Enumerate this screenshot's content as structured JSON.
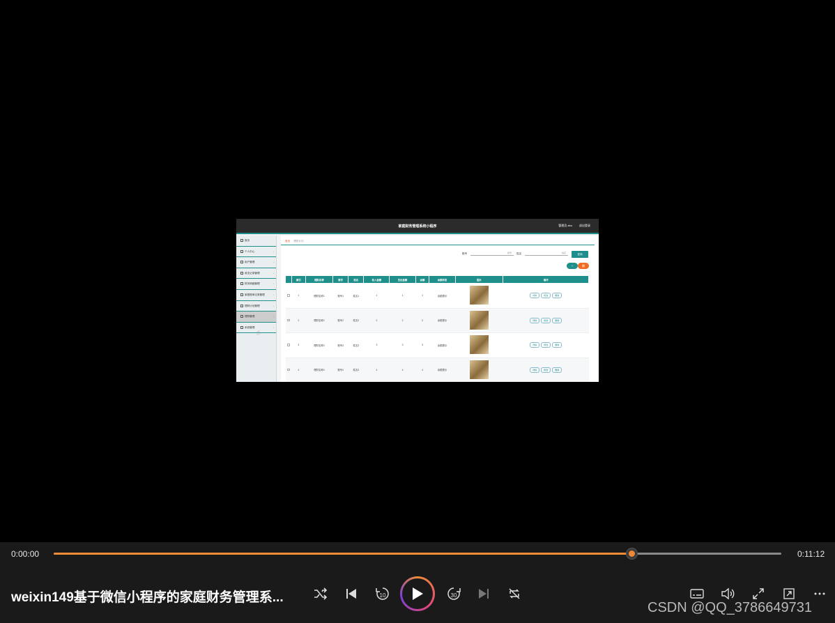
{
  "frame": {
    "app_title": "家庭财务管理系统小程序",
    "admin_label": "管理员 abo",
    "logout_label": "退出登录",
    "breadcrumb": {
      "home": "首页",
      "current": "理财计划"
    },
    "sidebar": [
      {
        "label": "首页",
        "icon": "home-icon"
      },
      {
        "label": "个人中心",
        "icon": "user-icon"
      },
      {
        "label": "用户管理",
        "icon": "grid-icon"
      },
      {
        "label": "收支记录管理",
        "icon": "chat-icon"
      },
      {
        "label": "财务明细管理",
        "icon": "tag-icon"
      },
      {
        "label": "家庭账单记录管理",
        "icon": "grid-icon"
      },
      {
        "label": "理财计划管理",
        "icon": "chart-icon"
      },
      {
        "label": "理财管理",
        "icon": "gear-icon"
      },
      {
        "label": "系统管理",
        "icon": "lock-icon"
      }
    ],
    "filters": {
      "account_label": "账号",
      "account_placeholder": "账号",
      "name_label": "姓名",
      "name_placeholder": "姓名",
      "query_button": "查询"
    },
    "add_button": "+",
    "delete_button": "删",
    "table": {
      "headers": [
        "",
        "索引",
        "理财名称",
        "账号",
        "姓名",
        "收入金额",
        "支出金额",
        "余额",
        "余额状态",
        "图片",
        "操作"
      ],
      "rows": [
        {
          "index": "1",
          "name": "理财名称1",
          "account": "账号1",
          "person": "姓名1",
          "income": "1",
          "expense": "1",
          "balance": "1",
          "status": "余额提示"
        },
        {
          "index": "2",
          "name": "理财名称2",
          "account": "账号2",
          "person": "姓名2",
          "income": "2",
          "expense": "2",
          "balance": "2",
          "status": "余额提示"
        },
        {
          "index": "3",
          "name": "理财名称3",
          "account": "账号3",
          "person": "姓名3",
          "income": "3",
          "expense": "3",
          "balance": "3",
          "status": "余额提示"
        },
        {
          "index": "4",
          "name": "理财名称4",
          "account": "账号4",
          "person": "姓名4",
          "income": "4",
          "expense": "4",
          "balance": "4",
          "status": "余额提示"
        }
      ],
      "ops": [
        "详情",
        "修改",
        "删除"
      ]
    }
  },
  "player": {
    "current_time": "0:00:00",
    "total_time": "0:11:12",
    "progress": 0.794,
    "title": "weixin149基于微信小程序的家庭财务管理系...",
    "accent": "#f08a37",
    "controls": [
      "shuffle-icon",
      "skip-previous-icon",
      "rewind-10-icon",
      "play-icon",
      "forward-30-icon",
      "skip-next-icon",
      "repeat-icon",
      "subtitles-icon",
      "volume-icon",
      "fullscreen-icon",
      "mini-player-icon",
      "more-icon"
    ],
    "rewind_label": "10",
    "forward_label": "30"
  },
  "watermark": "CSDN @QQ_3786649731"
}
